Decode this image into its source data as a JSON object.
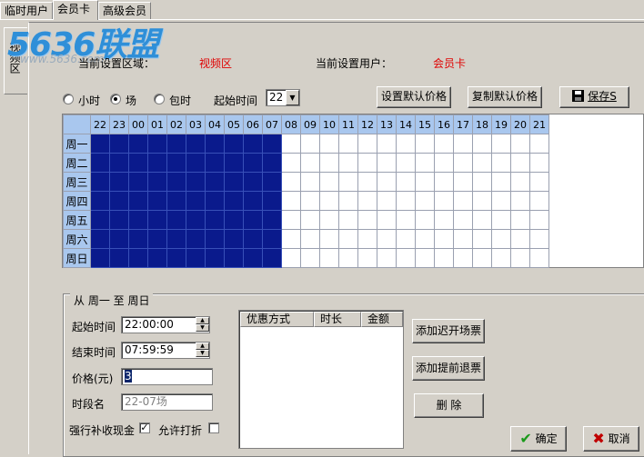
{
  "top_tabs": [
    "临时用户",
    "会员卡",
    "高级会员"
  ],
  "side_tab": "视频区",
  "logo": {
    "main": "5636联盟",
    "sub": "www.5636.com"
  },
  "header": {
    "area_label": "当前设置区域：",
    "area_value": "视频区",
    "user_label": "当前设置用户：",
    "user_value": "会员卡"
  },
  "billing_modes": [
    {
      "label": "小时",
      "selected": false
    },
    {
      "label": "场",
      "selected": true
    },
    {
      "label": "包时",
      "selected": false
    }
  ],
  "start_time_label": "起始时间",
  "start_time_value": "22",
  "buttons": {
    "set_default": "设置默认价格",
    "copy_default": "复制默认价格",
    "save": "保存S",
    "add_late": "添加迟开场票",
    "add_early": "添加提前退票",
    "delete": "删 除",
    "ok": "确定",
    "cancel": "取消"
  },
  "schedule": {
    "hours": [
      "22",
      "23",
      "00",
      "01",
      "02",
      "03",
      "04",
      "05",
      "06",
      "07",
      "08",
      "09",
      "10",
      "11",
      "12",
      "13",
      "14",
      "15",
      "16",
      "17",
      "18",
      "19",
      "20",
      "21"
    ],
    "days": [
      "周一",
      "周二",
      "周三",
      "周四",
      "周五",
      "周六",
      "周日"
    ],
    "selected_hours": [
      "22",
      "23",
      "00",
      "01",
      "02",
      "03",
      "04",
      "05",
      "06",
      "07"
    ]
  },
  "range": {
    "title": "从  周一  至  周日",
    "start_label": "起始时间",
    "start_value": "22:00:00",
    "end_label": "结束时间",
    "end_value": "07:59:59",
    "price_label": "价格(元)",
    "price_value": "3",
    "period_label": "时段名",
    "period_value": "22-07场",
    "force_cash_label": "强行补收现金",
    "force_cash_checked": true,
    "allow_discount_label": "允许打折",
    "allow_discount_checked": false
  },
  "discount_list": {
    "columns": [
      "优惠方式",
      "时长",
      "金额"
    ]
  },
  "colors": {
    "selected_cell": "#0a1a8c",
    "header_cell": "#a9c7ee",
    "value_red": "#e00000"
  }
}
